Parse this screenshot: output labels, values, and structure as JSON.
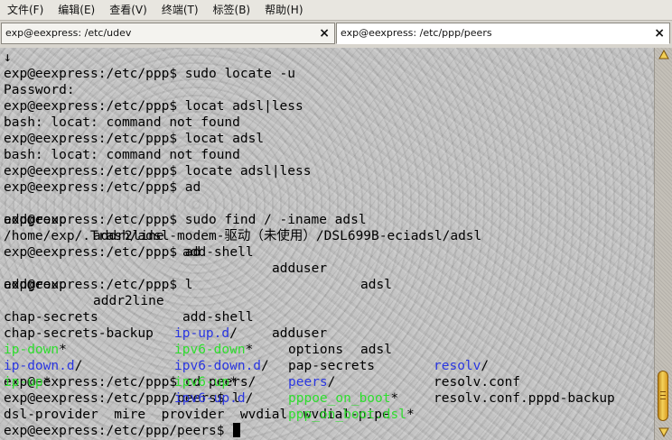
{
  "menu": [
    "文件(F)",
    "编辑(E)",
    "查看(V)",
    "终端(T)",
    "标签(B)",
    "帮助(H)"
  ],
  "tabs": [
    {
      "label": "exp@eexpress: /etc/udev",
      "close": "×"
    },
    {
      "label": "exp@eexpress: /etc/ppp/peers",
      "close": "×"
    }
  ],
  "terminal": {
    "prompt": "exp@eexpress:/etc/ppp$ ",
    "prompt_peers": "exp@eexpress:/etc/ppp/peers$ ",
    "top_char": "↓",
    "cmd_locate_u": "sudo locate -u",
    "password": "Password:",
    "cmd_locat_less": "locat adsl|less",
    "err_locat": "bash: locat: command not found",
    "cmd_locat": "locat adsl",
    "cmd_locate_less": "locate adsl|less",
    "cmd_ad": "ad",
    "completions": [
      "addgroup",
      "addr2line",
      "add-shell",
      "adduser",
      "adsl"
    ],
    "cmd_find": "sudo find / -iname adsl",
    "find_result": "/home/exp/.Trash/adsl-modem-驱动（未使用）/DSL699B-eciadsl/adsl",
    "cmd_l": "l",
    "ls": [
      [
        {
          "t": "chap-secrets",
          "c": ""
        },
        {
          "t": "ip-up.d",
          "c": "blue",
          "s": "/"
        },
        {
          "t": "options",
          "c": ""
        },
        {
          "t": "resolv",
          "c": "blue",
          "s": "/"
        }
      ],
      [
        {
          "t": "chap-secrets-backup",
          "c": ""
        },
        {
          "t": "ipv6-down",
          "c": "green",
          "s": "*"
        },
        {
          "t": "pap-secrets",
          "c": ""
        },
        {
          "t": "resolv.conf",
          "c": ""
        }
      ],
      [
        {
          "t": "ip-down",
          "c": "green",
          "s": "*"
        },
        {
          "t": "ipv6-down.d",
          "c": "blue",
          "s": "/"
        },
        {
          "t": "peers",
          "c": "blue",
          "s": "/"
        },
        {
          "t": "resolv.conf.pppd-backup",
          "c": ""
        }
      ],
      [
        {
          "t": "ip-down.d",
          "c": "blue",
          "s": "/"
        },
        {
          "t": "ipv6-up",
          "c": "green",
          "s": "*"
        },
        {
          "t": "pppoe_on_boot",
          "c": "green",
          "s": "*"
        },
        {
          "t": "",
          "c": ""
        }
      ],
      [
        {
          "t": "ip-up",
          "c": "green",
          "s": "*"
        },
        {
          "t": "ipv6-up.d",
          "c": "blue",
          "s": "/"
        },
        {
          "t": "ppp_on_boot.dsl",
          "c": "green",
          "s": "*"
        },
        {
          "t": "",
          "c": ""
        }
      ]
    ],
    "cmd_cd": "cd peers/",
    "peers_ls": "dsl-provider  mire  provider  wvdial  wvdial-pipe"
  },
  "colors": {
    "dir": "#2a36e0",
    "exec": "#2fdd2f",
    "thumb": "#f4d25c"
  }
}
